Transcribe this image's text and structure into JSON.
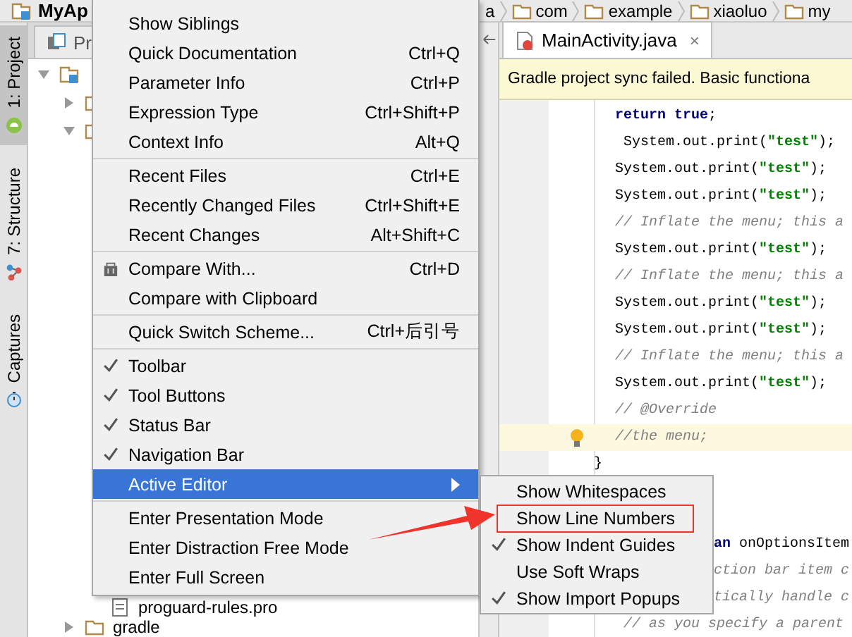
{
  "nav_bar": {
    "project": "MyAp",
    "crumbs": [
      {
        "kind": "text",
        "label": "a"
      },
      {
        "kind": "folder",
        "label": "com"
      },
      {
        "kind": "folder",
        "label": "example"
      },
      {
        "kind": "folder",
        "label": "xiaoluo"
      },
      {
        "kind": "folder",
        "label": "my"
      }
    ]
  },
  "tool_strip": [
    {
      "label": "1: Project",
      "selected": true
    },
    {
      "label": "7: Structure",
      "selected": false
    },
    {
      "label": "Captures",
      "selected": false
    }
  ],
  "project_panel": {
    "tab": "Pr",
    "tree": [
      {
        "kind": "module",
        "expanded": true,
        "children": [
          {
            "kind": "folder",
            "expanded": false
          },
          {
            "kind": "folder",
            "expanded": true,
            "children": [
              {
                "kind": "file",
                "label": "proguard-rules.pro"
              }
            ]
          },
          {
            "kind": "folder",
            "expanded": false,
            "label": "gradle"
          }
        ]
      }
    ]
  },
  "editor": {
    "tabs": [
      {
        "label": "MainActivity.java",
        "selected": true,
        "close": "×"
      }
    ],
    "banner": "Gradle project sync failed. Basic functiona",
    "lines": [
      {
        "kind": "code",
        "current": false,
        "parts": [
          {
            "kind": "keyword",
            "text": "return true"
          },
          {
            "kind": "plain",
            "text": ";"
          }
        ]
      },
      {
        "kind": "code",
        "current": false,
        "parts": [
          {
            "kind": "plain",
            "text": " System.out.print("
          },
          {
            "kind": "string",
            "text": "\"test\""
          },
          {
            "kind": "plain",
            "text": ");"
          }
        ]
      },
      {
        "kind": "code",
        "current": false,
        "parts": [
          {
            "kind": "plain",
            "text": "System.out.print("
          },
          {
            "kind": "string",
            "text": "\"test\""
          },
          {
            "kind": "plain",
            "text": ");"
          }
        ]
      },
      {
        "kind": "code",
        "current": false,
        "parts": [
          {
            "kind": "plain",
            "text": "System.out.print("
          },
          {
            "kind": "string",
            "text": "\"test\""
          },
          {
            "kind": "plain",
            "text": ");"
          }
        ]
      },
      {
        "kind": "code",
        "current": false,
        "parts": [
          {
            "kind": "comment",
            "text": "// Inflate the menu; this a"
          }
        ]
      },
      {
        "kind": "code",
        "current": false,
        "parts": [
          {
            "kind": "plain",
            "text": "System.out.print("
          },
          {
            "kind": "string",
            "text": "\"test\""
          },
          {
            "kind": "plain",
            "text": ");"
          }
        ]
      },
      {
        "kind": "code",
        "current": false,
        "parts": [
          {
            "kind": "comment",
            "text": "// Inflate the menu; this a"
          }
        ]
      },
      {
        "kind": "code",
        "current": false,
        "parts": [
          {
            "kind": "plain",
            "text": "System.out.print("
          },
          {
            "kind": "string",
            "text": "\"test\""
          },
          {
            "kind": "plain",
            "text": ");"
          }
        ]
      },
      {
        "kind": "code",
        "current": false,
        "parts": [
          {
            "kind": "plain",
            "text": "System.out.print("
          },
          {
            "kind": "string",
            "text": "\"test\""
          },
          {
            "kind": "plain",
            "text": ");"
          }
        ]
      },
      {
        "kind": "code",
        "current": false,
        "parts": [
          {
            "kind": "comment",
            "text": "// Inflate the menu; this a"
          }
        ]
      },
      {
        "kind": "code",
        "current": false,
        "parts": [
          {
            "kind": "plain",
            "text": "System.out.print("
          },
          {
            "kind": "string",
            "text": "\"test\""
          },
          {
            "kind": "plain",
            "text": ");"
          }
        ]
      },
      {
        "kind": "code",
        "current": false,
        "parts": [
          {
            "kind": "comment",
            "text": "// @Override"
          }
        ]
      },
      {
        "kind": "code",
        "current": true,
        "parts": [
          {
            "kind": "comment",
            "text": "//the menu;"
          }
        ]
      },
      {
        "kind": "brace",
        "current": false,
        "parts": [
          {
            "kind": "plain",
            "text": "}"
          }
        ]
      },
      {
        "kind": "blank",
        "current": false
      },
      {
        "kind": "blank",
        "current": false
      },
      {
        "kind": "tail",
        "current": false,
        "parts": [
          {
            "kind": "keyword",
            "text": "an"
          },
          {
            "kind": "plain",
            "text": " onOptionsItem"
          }
        ]
      },
      {
        "kind": "tail",
        "current": false,
        "parts": [
          {
            "kind": "comment",
            "text": "ction bar item c"
          }
        ]
      },
      {
        "kind": "tail",
        "current": false,
        "parts": [
          {
            "kind": "comment",
            "text": "tically handle c"
          }
        ]
      },
      {
        "kind": "code",
        "current": false,
        "parts": [
          {
            "kind": "comment",
            "text": " // as you specify a parent"
          }
        ]
      }
    ]
  },
  "menu": {
    "items": [
      {
        "kind": "item",
        "label": "Show Siblings",
        "checked": false,
        "selected": false
      },
      {
        "kind": "item",
        "label": "Quick Documentation",
        "shortcut": "Ctrl+Q",
        "checked": false,
        "selected": false
      },
      {
        "kind": "item",
        "label": "Parameter Info",
        "shortcut": "Ctrl+P",
        "checked": false,
        "selected": false
      },
      {
        "kind": "item",
        "label": "Expression Type",
        "shortcut": "Ctrl+Shift+P",
        "checked": false,
        "selected": false
      },
      {
        "kind": "item",
        "label": "Context Info",
        "shortcut": "Alt+Q",
        "checked": false,
        "selected": false
      },
      {
        "kind": "separator"
      },
      {
        "kind": "item",
        "label": "Recent Files",
        "shortcut": "Ctrl+E",
        "checked": false,
        "selected": false
      },
      {
        "kind": "item",
        "label": "Recently Changed Files",
        "shortcut": "Ctrl+Shift+E",
        "checked": false,
        "selected": false
      },
      {
        "kind": "item",
        "label": "Recent Changes",
        "shortcut": "Alt+Shift+C",
        "checked": false,
        "selected": false
      },
      {
        "kind": "separator"
      },
      {
        "kind": "icon-item",
        "label": "Compare With...",
        "shortcut": "Ctrl+D",
        "checked": false,
        "selected": false
      },
      {
        "kind": "item",
        "label": "Compare with Clipboard",
        "checked": false,
        "selected": false
      },
      {
        "kind": "separator"
      },
      {
        "kind": "item",
        "label": "Quick Switch Scheme...",
        "shortcut": "Ctrl+后引号",
        "checked": false,
        "selected": false
      },
      {
        "kind": "separator"
      },
      {
        "kind": "item",
        "label": "Toolbar",
        "checked": true,
        "selected": false
      },
      {
        "kind": "item",
        "label": "Tool Buttons",
        "checked": true,
        "selected": false
      },
      {
        "kind": "item",
        "label": "Status Bar",
        "checked": true,
        "selected": false
      },
      {
        "kind": "item",
        "label": "Navigation Bar",
        "checked": true,
        "selected": false
      },
      {
        "kind": "submenu",
        "label": "Active Editor",
        "checked": false,
        "selected": true
      },
      {
        "kind": "separator"
      },
      {
        "kind": "item",
        "label": "Enter Presentation Mode",
        "checked": false,
        "selected": false
      },
      {
        "kind": "item",
        "label": "Enter Distraction Free Mode",
        "checked": false,
        "selected": false
      },
      {
        "kind": "item",
        "label": "Enter Full Screen",
        "checked": false,
        "selected": false
      }
    ]
  },
  "submenu": {
    "items": [
      {
        "kind": "item",
        "label": "Show Whitespaces",
        "checked": false,
        "selected": false,
        "highlighted": false
      },
      {
        "kind": "item",
        "label": "Show Line Numbers",
        "checked": false,
        "selected": false,
        "highlighted": true
      },
      {
        "kind": "item",
        "label": "Show Indent Guides",
        "checked": true,
        "selected": false,
        "highlighted": false
      },
      {
        "kind": "item",
        "label": "Use Soft Wraps",
        "checked": false,
        "selected": false,
        "highlighted": false
      },
      {
        "kind": "item",
        "label": "Show Import Popups",
        "checked": true,
        "selected": false,
        "highlighted": false
      }
    ]
  },
  "annotations": {
    "arrow": true
  }
}
